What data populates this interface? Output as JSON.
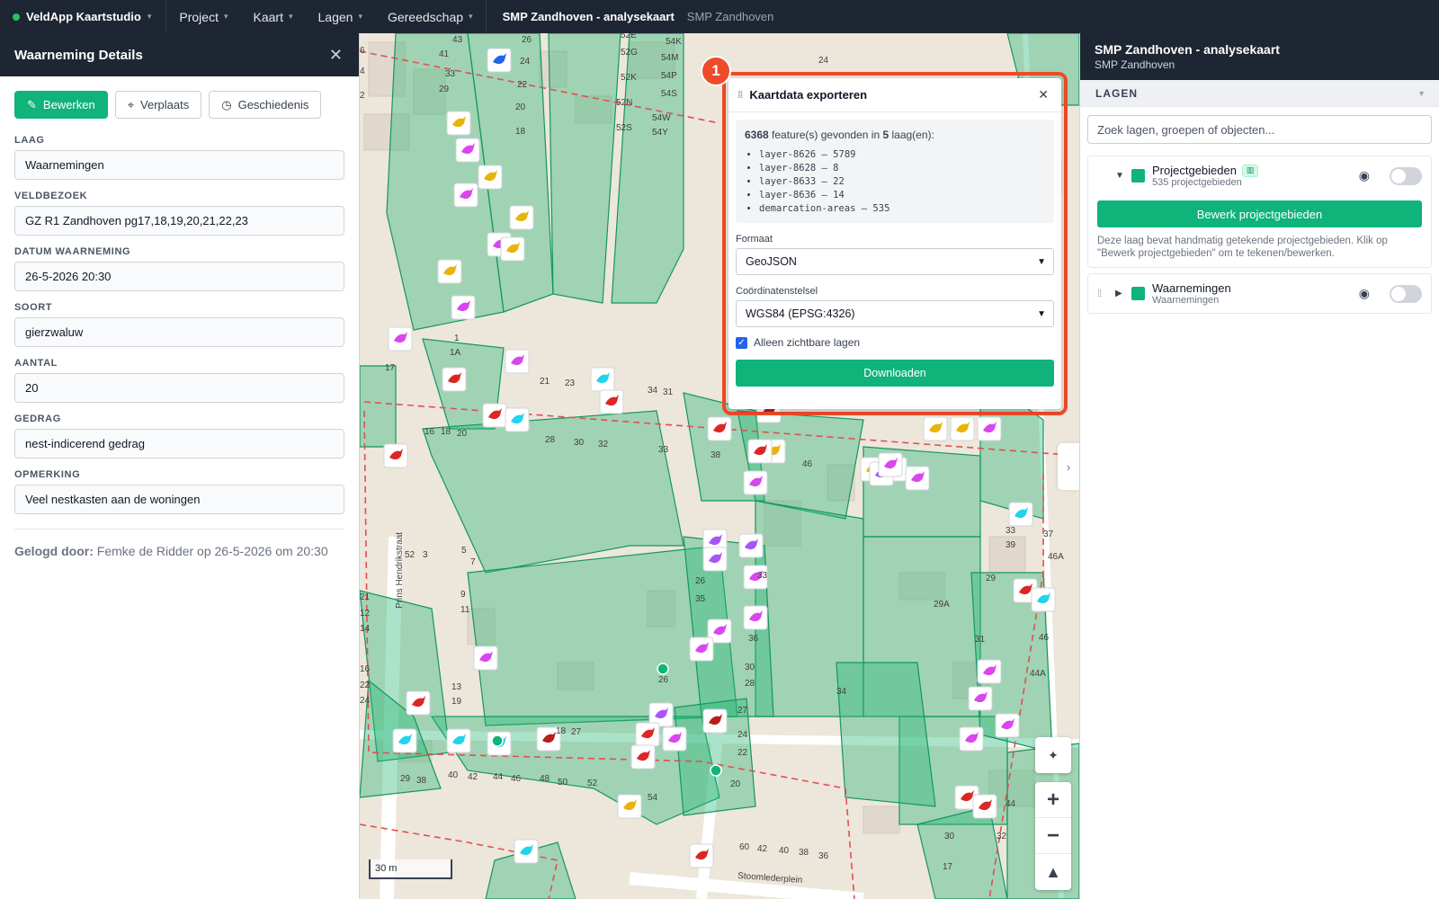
{
  "topbar": {
    "brand": "VeldApp Kaartstudio",
    "menu": [
      "Project",
      "Kaart",
      "Lagen",
      "Gereedschap"
    ],
    "title": "SMP Zandhoven - analysekaart",
    "subtitle": "SMP Zandhoven"
  },
  "left": {
    "title": "Waarneming Details",
    "buttons": {
      "edit": "Bewerken",
      "move": "Verplaats",
      "history": "Geschiedenis"
    },
    "fields": [
      {
        "label": "LAAG",
        "value": "Waarnemingen"
      },
      {
        "label": "VELDBEZOEK",
        "value": "GZ R1 Zandhoven pg17,18,19,20,21,22,23"
      },
      {
        "label": "DATUM WAARNEMING",
        "value": "26-5-2026 20:30"
      },
      {
        "label": "SOORT",
        "value": "gierzwaluw"
      },
      {
        "label": "AANTAL",
        "value": "20"
      },
      {
        "label": "GEDRAG",
        "value": "nest-indicerend gedrag"
      },
      {
        "label": "OPMERKING",
        "value": "Veel nestkasten aan de woningen"
      }
    ],
    "logged_label": "Gelogd door:",
    "logged_value": "Femke de Ridder op 26-5-2026 om 20:30"
  },
  "export": {
    "step": "1",
    "title": "Kaartdata exporteren",
    "count": "6368",
    "count_mid": " feature(s) gevonden in ",
    "layer_count": "5",
    "count_end": " laag(en):",
    "layers": [
      "layer-8626 — 5789",
      "layer-8628 — 8",
      "layer-8633 — 22",
      "layer-8636 — 14",
      "demarcation-areas — 535"
    ],
    "format_label": "Formaat",
    "format_value": "GeoJSON",
    "crs_label": "Coördinatenstelsel",
    "crs_value": "WGS84 (EPSG:4326)",
    "visible_only": "Alleen zichtbare lagen",
    "download": "Downloaden"
  },
  "map": {
    "scale": "30 m",
    "street_1": "Prins Hendrikstraat",
    "street_2": "Stoomlederplein",
    "house_numbers": [
      "43",
      "26",
      "24",
      "22",
      "20",
      "18",
      "41",
      "33",
      "29",
      "6",
      "4",
      "2",
      "52E",
      "52G",
      "52K",
      "52N",
      "52S",
      "54K",
      "54M",
      "54P",
      "54S",
      "54W",
      "54Y",
      "24",
      "1",
      "1A",
      "17",
      "21",
      "23",
      "16",
      "18",
      "20",
      "28",
      "30",
      "32",
      "34",
      "31",
      "33",
      "38",
      "46",
      "52",
      "3",
      "5",
      "7",
      "9",
      "11",
      "13",
      "19",
      "21",
      "12",
      "14",
      "16",
      "22",
      "24",
      "26",
      "35",
      "33",
      "36",
      "30",
      "28",
      "26",
      "27",
      "24",
      "22",
      "20",
      "18",
      "27",
      "29",
      "38",
      "40",
      "42",
      "44",
      "46",
      "48",
      "50",
      "52",
      "54",
      "60",
      "42",
      "40",
      "38",
      "36",
      "34",
      "29A",
      "31",
      "29",
      "33",
      "39",
      "37",
      "46A",
      "46",
      "44A",
      "44",
      "32",
      "30",
      "17",
      "19"
    ]
  },
  "right": {
    "title": "SMP Zandhoven - analysekaart",
    "subtitle": "SMP Zandhoven",
    "layers_header": "LAGEN",
    "search_placeholder": "Zoek lagen, groepen of objecten...",
    "layer1": {
      "name": "Projectgebieden",
      "sub": "535 projectgebieden",
      "edit": "Bewerk projectgebieden",
      "hint": "Deze laag bevat handmatig getekende projectgebieden. Klik op \"Bewerk projectgebieden\" om te tekenen/bewerken."
    },
    "layer2": {
      "name": "Waarnemingen",
      "sub": "Waarnemingen"
    }
  },
  "colors": {
    "accent": "#10b37a",
    "highlight": "#ef4b2a",
    "header": "#1e2633"
  }
}
